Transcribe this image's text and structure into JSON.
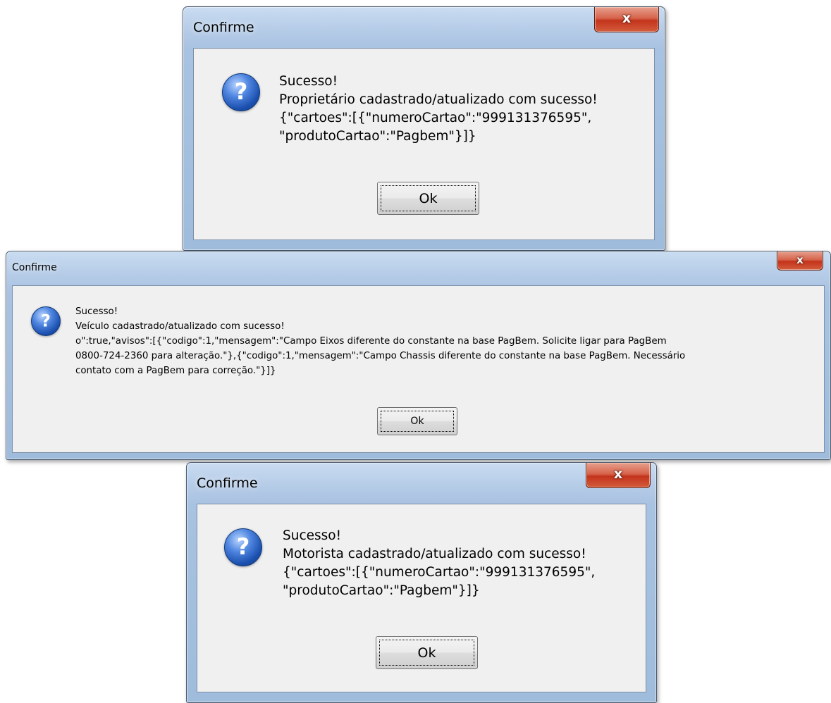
{
  "dialogs": [
    {
      "title": "Confirme",
      "close_glyph": "x",
      "icon": "question-icon",
      "lines": [
        "Sucesso!",
        "Proprietário cadastrado/atualizado com sucesso!",
        "{\"cartoes\":[{\"numeroCartao\":\"999131376595\",",
        "\"produtoCartao\":\"Pagbem\"}]}"
      ],
      "ok_label": "Ok"
    },
    {
      "title": "Confirme",
      "close_glyph": "x",
      "icon": "question-icon",
      "lines": [
        "Sucesso!",
        "Veículo cadastrado/atualizado com sucesso!",
        "o\":true,\"avisos\":[{\"codigo\":1,\"mensagem\":\"Campo Eixos diferente do constante na base PagBem. Solicite ligar para PagBem",
        "0800-724-2360 para alteração.\"},{\"codigo\":1,\"mensagem\":\"Campo Chassis diferente do constante na base PagBem. Necessário",
        "contato com a PagBem para correção.\"}]}"
      ],
      "ok_label": "Ok"
    },
    {
      "title": "Confirme",
      "close_glyph": "x",
      "icon": "question-icon",
      "lines": [
        "Sucesso!",
        "Motorista cadastrado/atualizado com sucesso!",
        "{\"cartoes\":[{\"numeroCartao\":\"999131376595\",",
        "\"produtoCartao\":\"Pagbem\"}]}"
      ],
      "ok_label": "Ok"
    }
  ],
  "icon_glyph": "?",
  "colors": {
    "client_bg": "#f0f0f0",
    "frame_blue": "#a8c2e1",
    "close_red": "#c3341c",
    "icon_blue": "#1b4fae"
  }
}
